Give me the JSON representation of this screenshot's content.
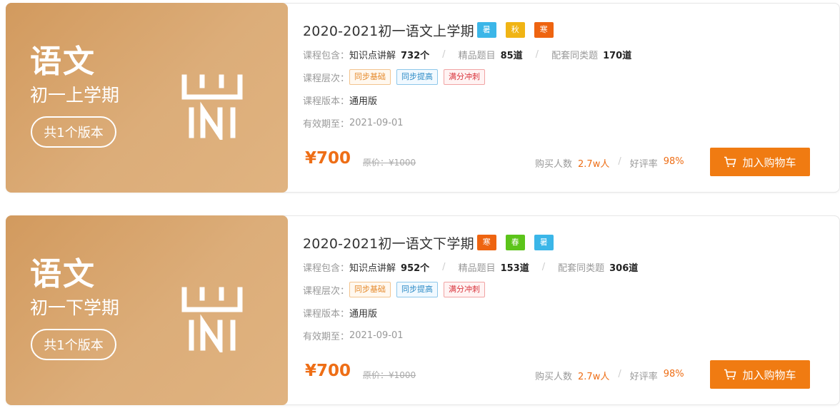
{
  "courses": [
    {
      "cover": {
        "subject": "语文",
        "term": "初一上学期",
        "versions": "共1个版本"
      },
      "title": "2020-2021初一语文上学期",
      "seasons": [
        {
          "label": "暑",
          "color": "#3bb6e8"
        },
        {
          "label": "秋",
          "color": "#f0b414"
        },
        {
          "label": "寒",
          "color": "#ee6410"
        }
      ],
      "contents_label": "课程包含：",
      "knowledge_label": "知识点讲解",
      "knowledge_count": "732个",
      "questions_label": "精品题目",
      "questions_count": "85道",
      "similar_label": "配套同类题",
      "similar_count": "170道",
      "level_label": "课程层次：",
      "levels": [
        "同步基础",
        "同步提高",
        "满分冲刺"
      ],
      "version_label": "课程版本：",
      "version": "通用版",
      "expiry_label": "有效期至：",
      "expiry": "2021-09-01",
      "price": "¥700",
      "original_price": "原价：¥1000",
      "buyers_label": "购买人数",
      "buyers": "2.7w人",
      "rating_label": "好评率",
      "rating": "98%",
      "cart_label": "加入购物车"
    },
    {
      "cover": {
        "subject": "语文",
        "term": "初一下学期",
        "versions": "共1个版本"
      },
      "title": "2020-2021初一语文下学期",
      "seasons": [
        {
          "label": "寒",
          "color": "#ee6410"
        },
        {
          "label": "春",
          "color": "#5cc41a"
        },
        {
          "label": "暑",
          "color": "#3bb6e8"
        }
      ],
      "contents_label": "课程包含：",
      "knowledge_label": "知识点讲解",
      "knowledge_count": "952个",
      "questions_label": "精品题目",
      "questions_count": "153道",
      "similar_label": "配套同类题",
      "similar_count": "306道",
      "level_label": "课程层次：",
      "levels": [
        "同步基础",
        "同步提高",
        "满分冲刺"
      ],
      "version_label": "课程版本：",
      "version": "通用版",
      "expiry_label": "有效期至：",
      "expiry": "2021-09-01",
      "price": "¥700",
      "original_price": "原价：¥1000",
      "buyers_label": "购买人数",
      "buyers": "2.7w人",
      "rating_label": "好评率",
      "rating": "98%",
      "cart_label": "加入购物车"
    }
  ]
}
